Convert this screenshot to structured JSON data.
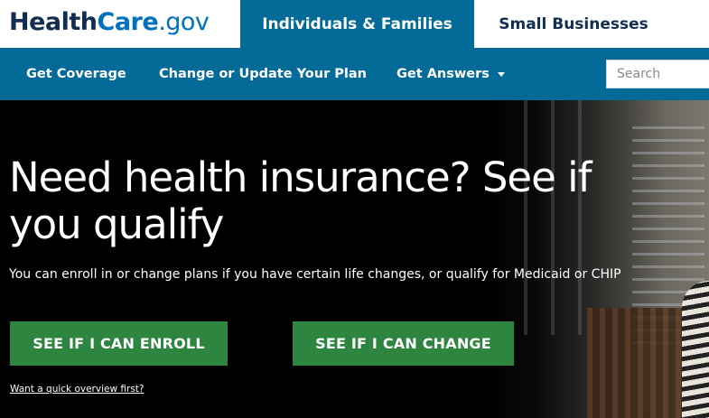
{
  "header": {
    "logo": {
      "part1": "Health",
      "part2": "Care",
      "part3": ".gov"
    },
    "tabs": [
      {
        "label": "Individuals & Families",
        "active": true
      },
      {
        "label": "Small Businesses",
        "active": false
      }
    ]
  },
  "nav": {
    "items": [
      {
        "label": "Get Coverage"
      },
      {
        "label": "Change or Update Your Plan"
      },
      {
        "label": "Get Answers",
        "dropdown": true
      }
    ],
    "search": {
      "placeholder": "Search",
      "value": ""
    }
  },
  "hero": {
    "headline": "Need health insurance? See if you qualify",
    "subtext": "You can enroll in or change plans if you have certain life changes, or qualify for Medicaid or CHIP",
    "buttons": {
      "enroll": "SEE IF I CAN ENROLL",
      "change": "SEE IF I CAN CHANGE"
    },
    "overview_link": "Want a quick overview first?"
  },
  "colors": {
    "nav_blue": "#046b99",
    "brand_dark": "#112e51",
    "brand_blue": "#0071bc",
    "button_green": "#2e8540"
  }
}
